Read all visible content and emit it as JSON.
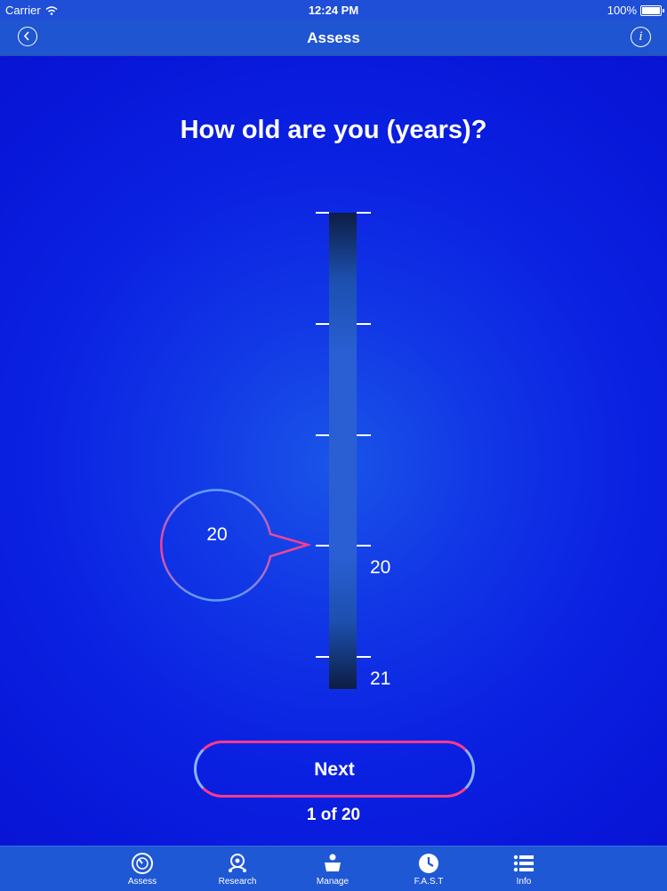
{
  "status_bar": {
    "carrier": "Carrier",
    "time": "12:24 PM",
    "battery": "100%"
  },
  "nav": {
    "title": "Assess",
    "back_icon": "chevron-left-icon",
    "info_icon": "info-icon"
  },
  "question": "How old are you (years)?",
  "slider": {
    "tick_labels": [
      "20",
      "21"
    ],
    "selected_value": "20"
  },
  "next_button": "Next",
  "progress": "1 of 20",
  "tabs": [
    {
      "label": "Assess",
      "icon": "gauge-icon"
    },
    {
      "label": "Research",
      "icon": "research-icon"
    },
    {
      "label": "Manage",
      "icon": "manage-icon"
    },
    {
      "label": "F.A.S.T",
      "icon": "clock-icon"
    },
    {
      "label": "Info",
      "icon": "list-icon"
    }
  ],
  "colors": {
    "accent_pink": "#ff3a8a",
    "accent_blue": "#5aa0ff",
    "background": "#0a1fe0"
  }
}
